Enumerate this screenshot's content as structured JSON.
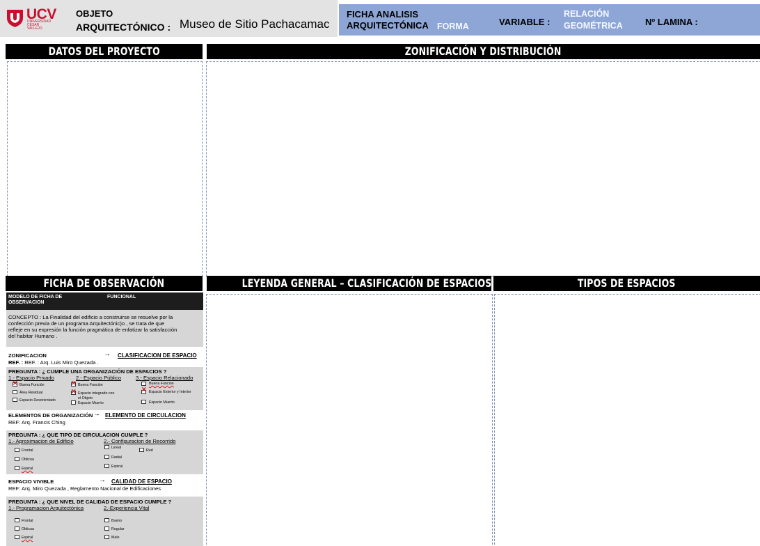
{
  "header": {
    "logo": {
      "name": "UCV",
      "sub1": "UNIVERSIDAD",
      "sub2": "CÉSAR VALLEJO"
    },
    "objeto_label_1": "OBJETO",
    "objeto_label_2": "ARQUITECTÓNICO :",
    "objeto_value": "Museo de Sitio Pachacamac",
    "ficha_label_1": "FICHA ANALISIS",
    "ficha_label_2": "ARQUITECTÓNICA",
    "ficha_value": "FORMA",
    "variable_label": "VARIABLE :",
    "variable_value_1": "RELACIÓN",
    "variable_value_2": "GEOMÉTRICA",
    "lamina_label": "Nº LAMINA :",
    "colors": {
      "header_grey": "#e3e3e3",
      "header_blue": "#8ea6d6",
      "logo_red": "#c8102e"
    }
  },
  "sections": {
    "datos": "DATOS DEL PROYECTO",
    "zonificacion": "ZONIFICACIÓN Y DISTRIBUCIÓN",
    "ficha": "FICHA DE OBSERVACIÓN",
    "leyenda": "LEYENDA GENERAL – CLASIFICACIÓN DE ESPACIOS",
    "tipos": "TIPOS DE ESPACIOS"
  },
  "ficha": {
    "head_left_1": "MODELO DE FICHA DE",
    "head_left_2": "OBSERVACION",
    "head_right": "FUNCIONAL",
    "concepto_1": "CONCEPTO : La Finalidad del edificio a construirse se resuelve por la",
    "concepto_2": "confección previa de un programa Arquitectónic)o , se trata de que",
    "concepto_3": "refleje en su expresión la función pragmática de enfatizar la satisfacción",
    "concepto_4": "del habitar Humano .",
    "zonificacion_label": "ZONIFICACION",
    "zonificacion_arrow": "→",
    "zonificacion_target": "CLASIFICACION DE ESPACIO",
    "zonificacion_ref": "REF. : Arq. Luis Miro Quezada .",
    "pregunta1": "PREGUNTA : ¿ CUMPLE UNA ORGANIZACIÓN DE ESPACIOS ?",
    "col1_title": "1.- Espacio Privado",
    "col2_title": "2.- Espacio Público",
    "col3_title": "3.- Espacio Relacionado",
    "col1_items": [
      "Buena Función",
      "Área Residual",
      "Espacio Desorientado"
    ],
    "col2_items": [
      "Buena Función",
      "Espacio integrado con",
      "el Objeto",
      "Espacio Muerto"
    ],
    "col3_items": [
      "Buena Funcion",
      "Espacio Exterior y Interior",
      "Espacio Muerto"
    ],
    "elementos_label": "ELEMENTOS DE ORGANIZACIÓN",
    "elementos_arrow": "→",
    "elementos_target": "ELEMENTO DE CIRCULACION",
    "elementos_ref": "REF: Arq. Francis Ching",
    "pregunta2": "PREGUNTA : ¿ QUE TIPO DE CIRCULACION CUMPLE ?",
    "circ_col1_title": "1.- Aproximacion de Edificio",
    "circ_col2_title": "2.- Configuracion de Recorrido",
    "circ_col1_items": [
      "Frontal",
      "Oblicua",
      "Espiral"
    ],
    "circ_col2_items": [
      "Lineal",
      "Red",
      "Radial",
      "Espiral"
    ],
    "espacio_label": "ESPACIO VIVIBLE",
    "espacio_arrow": "→",
    "espacio_target": "CALIDAD DE ESPACIO",
    "espacio_ref": "REF: Arq. Miro Quezada , Reglamento Nacional de Edificaciones",
    "pregunta3": "PREGUNTA : ¿ QUE NIVEL DE CALIDAD DE ESPACIO CUMPLE ?",
    "cal_col1_title": "1.- Programacion Arquitectónica",
    "cal_col2_title": "2.-Experiencia Vital",
    "cal_col1_items": [
      "Frontal",
      "Oblicua",
      "Espiral"
    ],
    "cal_col2_items": [
      "Bueno",
      "Regular",
      "Malo"
    ]
  }
}
